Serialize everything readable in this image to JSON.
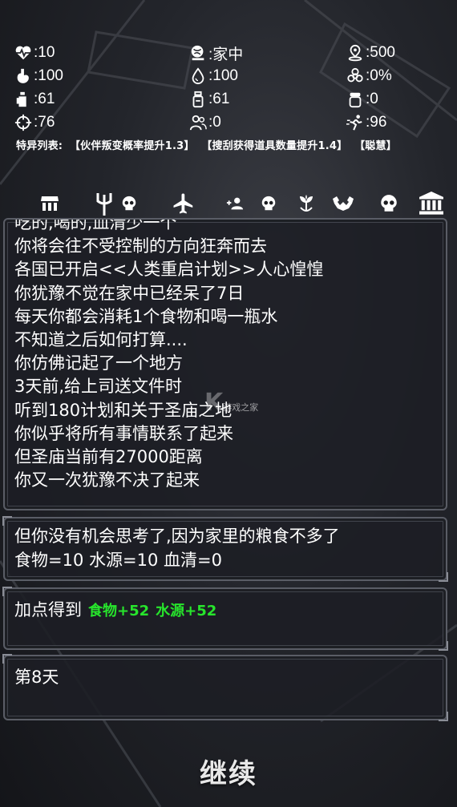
{
  "stats": {
    "health": ":10",
    "location": ":家中",
    "distance": ":500",
    "food": ":100",
    "water": ":100",
    "infection": ":0%",
    "strength": ":61",
    "energy": ":61",
    "item": ":0",
    "aim": ":76",
    "companions": ":0",
    "speed": ":96"
  },
  "traits": {
    "label": "特异列表:",
    "items": [
      "【伙伴叛变概率提升1.3】",
      "【搜刮获得道具数量提升1.4】",
      "【聪慧】"
    ]
  },
  "iconbar": [
    "shop-icon",
    "trident-icon",
    "skull-icon",
    "plane-icon",
    "add-person-icon",
    "skull-icon",
    "plant-icon",
    "muscle-icon",
    "skull-icon",
    "bank-icon"
  ],
  "story": {
    "lines": [
      "吃的,喝的,血清少一个",
      "你将会往不受控制的方向狂奔而去",
      "各国已开启<<人类重启计划>>人心惶惶",
      "你犹豫不觉在家中已经呆了7日",
      "每天你都会消耗1个食物和喝一瓶水",
      "不知道之后如何打算....",
      "你仿佛记起了一个地方",
      "3天前,给上司送文件时",
      "听到180计划和关于圣庙之地",
      "你似乎将所有事情联系了起来",
      "但圣庙当前有27000距离",
      "你又一次犹豫不决了起来"
    ]
  },
  "panel2": {
    "line1": "但你没有机会思考了,因为家里的粮食不多了",
    "line2": "食物=10  水源=10  血清=0"
  },
  "panel3": {
    "label": "加点得到",
    "food_gain": "食物+52",
    "water_gain": "水源+52"
  },
  "panel4": {
    "day": "第8天"
  },
  "continue_label": "继续",
  "watermark": "游戏之家",
  "colors": {
    "gain": "#27e52c",
    "panel_border": "#5a5d66"
  }
}
